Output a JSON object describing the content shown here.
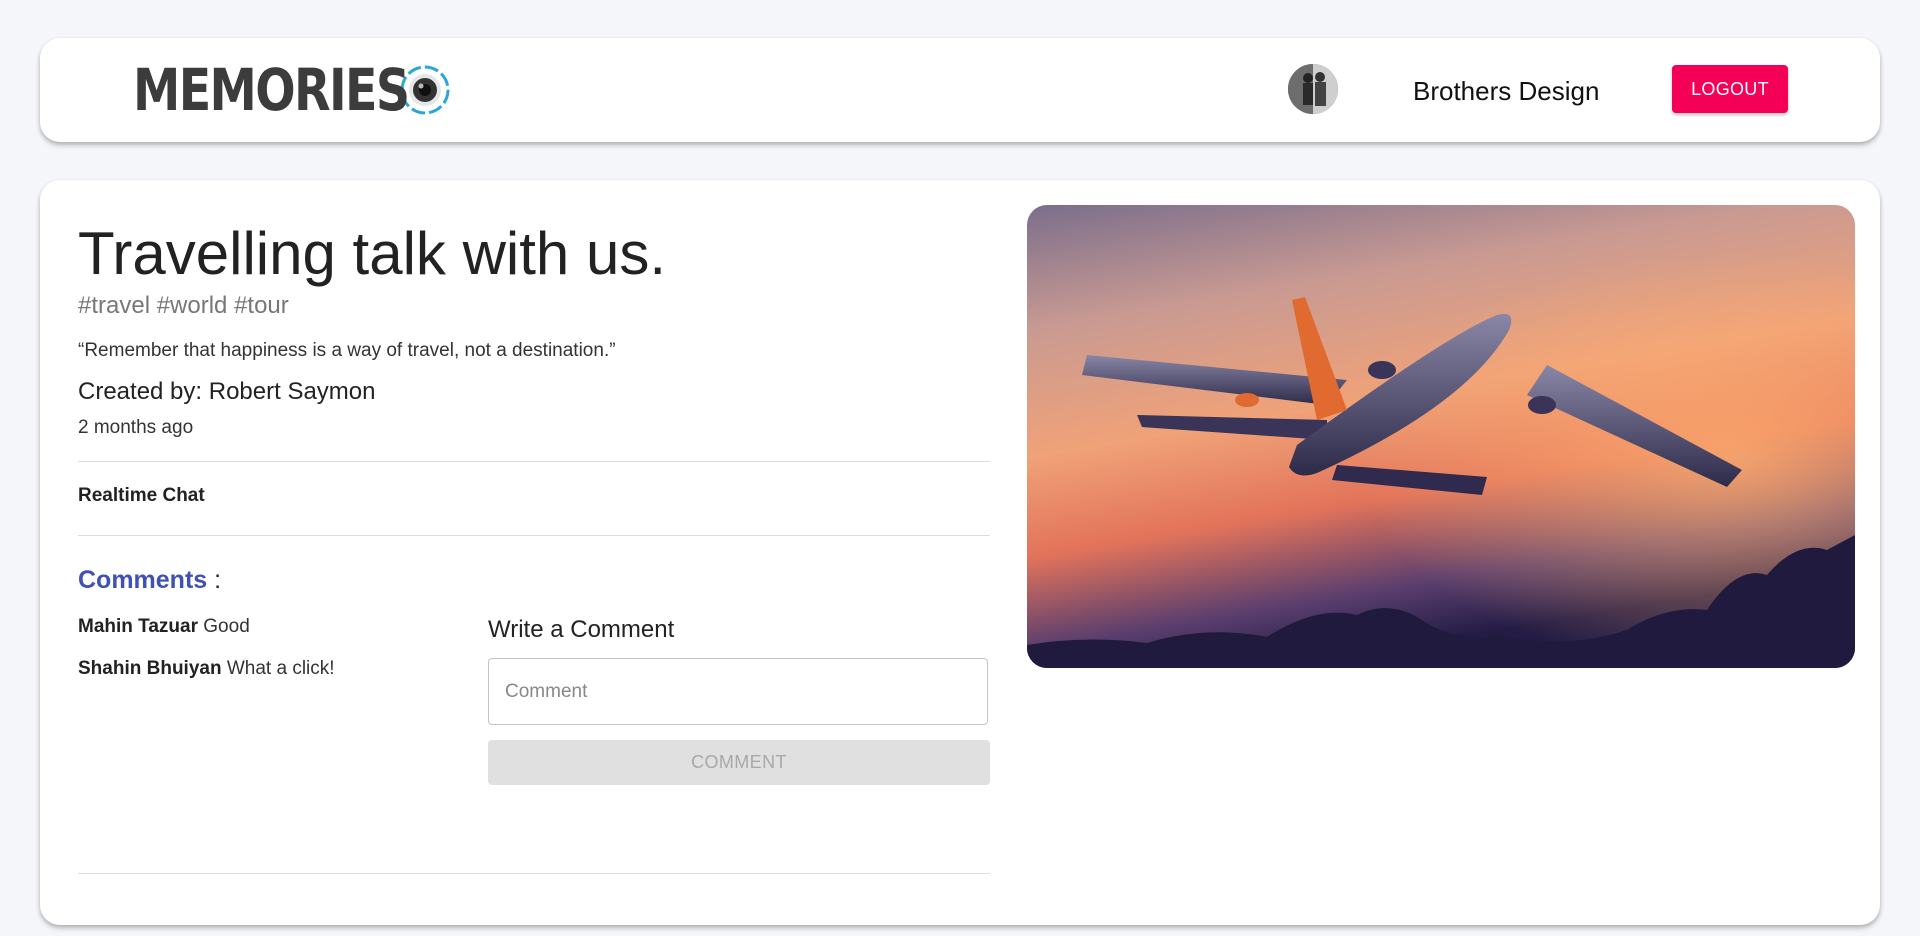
{
  "appbar": {
    "brand": "MEMORIES",
    "brand_icon": "camera-lens-icon",
    "user_name": "Brothers Design",
    "logout_label": "LOGOUT",
    "accent_color": "#f50057"
  },
  "post": {
    "title": "Travelling talk with us.",
    "tags": "#travel #world #tour",
    "message": "“Remember that happiness is a way of travel, not a destination.”",
    "creator": "Created by: Robert Saymon",
    "time": "2 months ago",
    "image_subject": "airplane-at-sunset"
  },
  "chat": {
    "label": "Realtime Chat"
  },
  "comments": {
    "heading": "Comments",
    "colon": ":",
    "heading_color": "#3f51b5",
    "items": [
      {
        "author": "Mahin Tazuar",
        "text": "Good"
      },
      {
        "author": "Shahin Bhuiyan",
        "text": "What a click!"
      }
    ],
    "write_title": "Write a Comment",
    "input_placeholder": "Comment",
    "submit_label": "COMMENT"
  }
}
